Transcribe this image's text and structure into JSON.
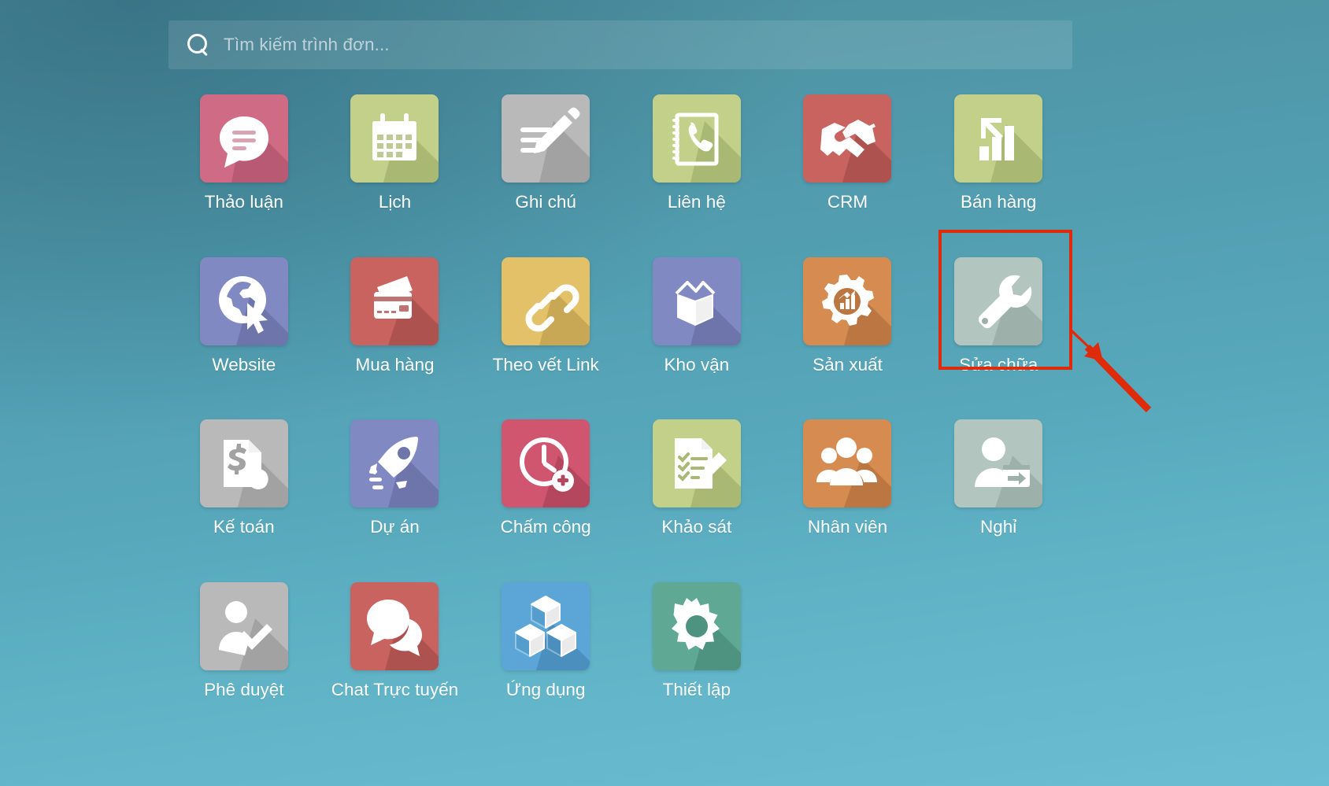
{
  "search": {
    "placeholder": "Tìm kiếm trình đơn...",
    "value": "",
    "icon": "search-icon"
  },
  "apps": [
    {
      "label": "Thảo luận",
      "icon": "discuss-speech-bubble-icon",
      "tile_color": "#d06b85",
      "shadow_color": "#b85a73"
    },
    {
      "label": "Lịch",
      "icon": "calendar-icon",
      "tile_color": "#c3d08a",
      "shadow_color": "#a9b873"
    },
    {
      "label": "Ghi chú",
      "icon": "notes-pencil-icon",
      "tile_color": "#b9b9b9",
      "shadow_color": "#a2a2a2"
    },
    {
      "label": "Liên hệ",
      "icon": "contacts-phonebook-icon",
      "tile_color": "#c3d08a",
      "shadow_color": "#a9b873"
    },
    {
      "label": "CRM",
      "icon": "handshake-icon",
      "tile_color": "#c8635f",
      "shadow_color": "#ae524f"
    },
    {
      "label": "Bán hàng",
      "icon": "sales-bar-chart-arrow-icon",
      "tile_color": "#c3d08a",
      "shadow_color": "#a9b873"
    },
    {
      "label": "Website",
      "icon": "website-globe-cursor-icon",
      "tile_color": "#8189c2",
      "shadow_color": "#6d75ab"
    },
    {
      "label": "Mua hàng",
      "icon": "purchase-credit-cards-icon",
      "tile_color": "#c8635f",
      "shadow_color": "#ae524f"
    },
    {
      "label": "Theo vết Link",
      "icon": "link-tracker-chain-icon",
      "tile_color": "#e3c169",
      "shadow_color": "#c9a855"
    },
    {
      "label": "Kho vận",
      "icon": "inventory-open-box-icon",
      "tile_color": "#8189c2",
      "shadow_color": "#6d75ab"
    },
    {
      "label": "Sản xuất",
      "icon": "manufacturing-gear-chart-icon",
      "tile_color": "#d68b51",
      "shadow_color": "#bb7641"
    },
    {
      "label": "Sửa chữa",
      "icon": "repair-wrench-icon",
      "tile_color": "#b2c6bf",
      "shadow_color": "#9db1aa",
      "highlighted": true
    },
    {
      "label": "Kế toán",
      "icon": "accounting-invoice-dollar-icon",
      "tile_color": "#b9b9b9",
      "shadow_color": "#a2a2a2"
    },
    {
      "label": "Dự án",
      "icon": "project-rocket-icon",
      "tile_color": "#8189c2",
      "shadow_color": "#6d75ab"
    },
    {
      "label": "Chấm công",
      "icon": "attendance-clock-plus-icon",
      "tile_color": "#d0566f",
      "shadow_color": "#b4475d"
    },
    {
      "label": "Khảo sát",
      "icon": "survey-checklist-pencil-icon",
      "tile_color": "#c3d08a",
      "shadow_color": "#a9b873"
    },
    {
      "label": "Nhân viên",
      "icon": "employees-people-icon",
      "tile_color": "#d68b51",
      "shadow_color": "#bb7641"
    },
    {
      "label": "Nghỉ",
      "icon": "timeoff-person-calendar-icon",
      "tile_color": "#b2c6bf",
      "shadow_color": "#9db1aa"
    },
    {
      "label": "Phê duyệt",
      "icon": "approvals-person-check-icon",
      "tile_color": "#b9b9b9",
      "shadow_color": "#a2a2a2"
    },
    {
      "label": "Chat Trực tuyến",
      "icon": "livechat-bubbles-icon",
      "tile_color": "#c8635f",
      "shadow_color": "#ae524f"
    },
    {
      "label": "Ứng dụng",
      "icon": "apps-cubes-icon",
      "tile_color": "#5ba6d6",
      "shadow_color": "#4a8fbd"
    },
    {
      "label": "Thiết lập",
      "icon": "settings-gear-icon",
      "tile_color": "#5fa894",
      "shadow_color": "#4e9280"
    }
  ],
  "annotation": {
    "highlight_target": "Sửa chữa",
    "box_color": "#e02b0a",
    "arrow_color": "#e02b0a"
  },
  "theme": {
    "background_top": "#4d8e9d",
    "background_bottom": "#6bbdd2",
    "label_color": "#ffffff"
  }
}
